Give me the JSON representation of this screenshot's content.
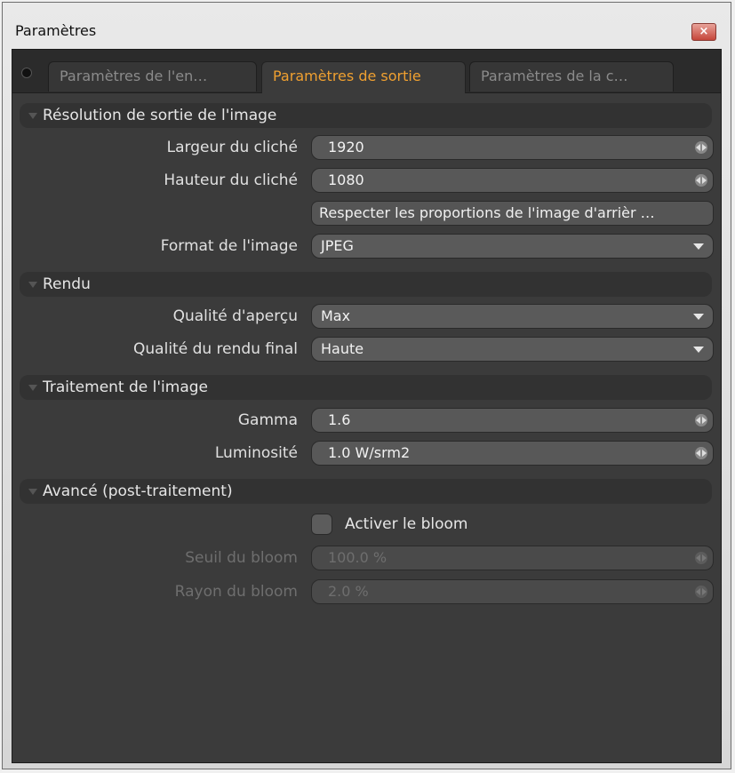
{
  "window": {
    "title": "Paramètres",
    "close_label": "×"
  },
  "tabs": [
    {
      "label": "Paramètres de l'en…",
      "active": false
    },
    {
      "label": "Paramètres de sortie",
      "active": true
    },
    {
      "label": "Paramètres de la c…",
      "active": false
    }
  ],
  "sections": {
    "resolution": {
      "title": "Résolution de sortie de l'image",
      "width_label": "Largeur du cliché",
      "width_value": "1920",
      "height_label": "Hauteur du cliché",
      "height_value": "1080",
      "aspect_button": "Respecter les proportions de l'image d'arrièr …",
      "format_label": "Format de l'image",
      "format_value": "JPEG"
    },
    "render": {
      "title": "Rendu",
      "preview_label": "Qualité d'aperçu",
      "preview_value": "Max",
      "final_label": "Qualité du rendu final",
      "final_value": "Haute"
    },
    "processing": {
      "title": "Traitement de l'image",
      "gamma_label": "Gamma",
      "gamma_value": "1.6",
      "luminosity_label": "Luminosité",
      "luminosity_value": "1.0 W/srm2"
    },
    "advanced": {
      "title": "Avancé (post-traitement)",
      "bloom_checkbox_label": "Activer le bloom",
      "bloom_enabled": false,
      "threshold_label": "Seuil du bloom",
      "threshold_value": "100.0 %",
      "radius_label": "Rayon du bloom",
      "radius_value": "2.0 %"
    }
  },
  "colors": {
    "accent": "#f0a030",
    "panel": "#3b3b3b",
    "field": "#585858"
  }
}
